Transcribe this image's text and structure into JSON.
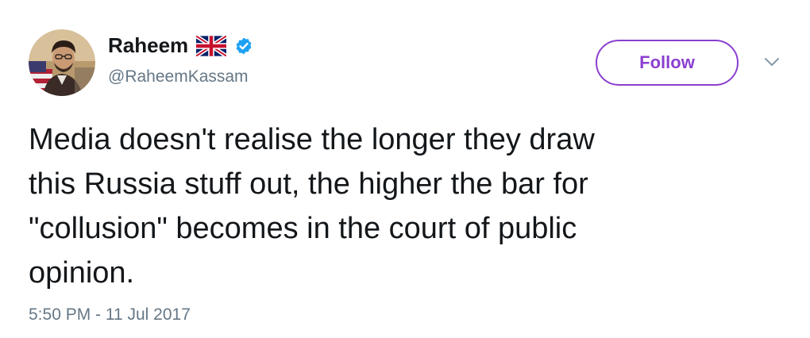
{
  "author": {
    "name": "Raheem",
    "handle": "@RaheemKassam",
    "flag_icon": "union-jack-flag-icon",
    "verified_icon": "verified-badge-icon",
    "verified_color": "#1da1f2"
  },
  "follow_button": {
    "label": "Follow",
    "color": "#8b3fd0"
  },
  "menu": {
    "icon": "chevron-down-icon"
  },
  "tweet": {
    "text": "Media doesn't realise the longer they draw\nthis Russia stuff out, the higher the bar for\n\"collusion\" becomes in the court of public\nopinion.",
    "timestamp": "5:50 PM - 11 Jul 2017"
  }
}
